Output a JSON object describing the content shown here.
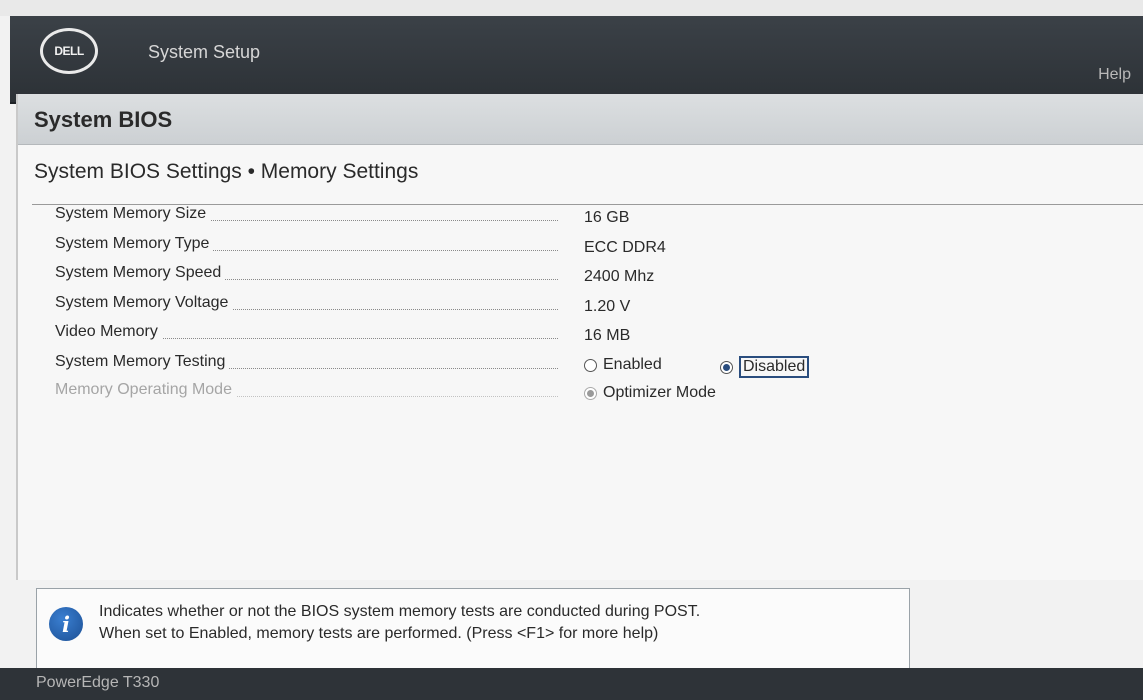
{
  "header": {
    "logo_text": "DELL",
    "app_title": "System Setup",
    "help_label": "Help"
  },
  "page": {
    "title": "System BIOS",
    "breadcrumb": "System BIOS Settings • Memory Settings"
  },
  "settings": [
    {
      "label": "System Memory Size",
      "value": "16 GB"
    },
    {
      "label": "System Memory Type",
      "value": "ECC DDR4"
    },
    {
      "label": "System Memory Speed",
      "value": "2400 Mhz"
    },
    {
      "label": "System Memory Voltage",
      "value": "1.20 V"
    },
    {
      "label": "Video Memory",
      "value": "16 MB"
    },
    {
      "label": "System Memory Testing",
      "options": [
        "Enabled",
        "Disabled"
      ],
      "selected": "Disabled"
    },
    {
      "label": "Memory Operating Mode",
      "options": [
        "Optimizer Mode"
      ],
      "selected": "Optimizer Mode",
      "enabled": false
    }
  ],
  "help_box": {
    "icon": "info-icon",
    "line1": "Indicates whether or not the BIOS system memory tests are conducted during POST.",
    "line2": "When set to Enabled, memory tests are performed. (Press <F1> for more help)"
  },
  "footer": {
    "model": "PowerEdge T330"
  }
}
